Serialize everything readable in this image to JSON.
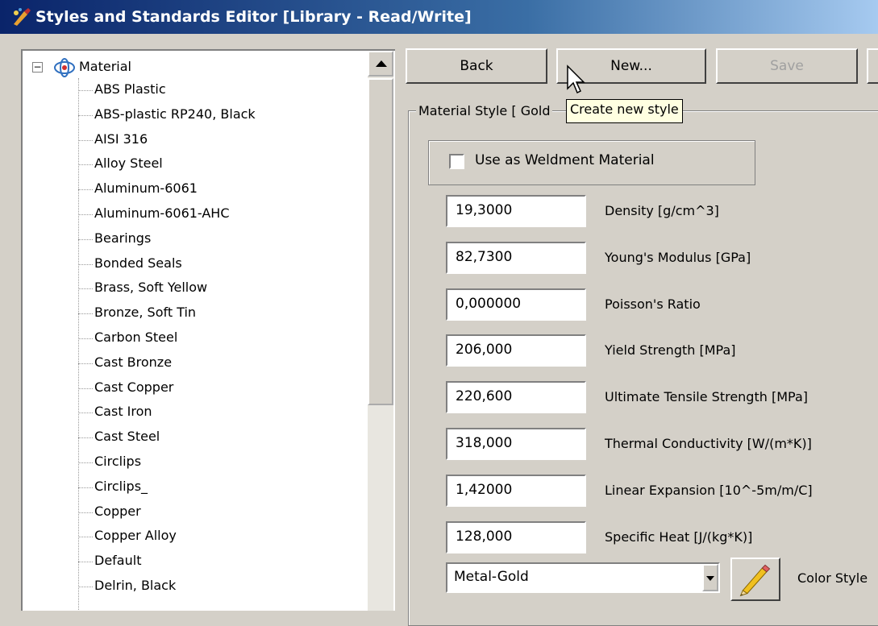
{
  "window": {
    "title": "Styles and Standards Editor [Library - Read/Write]",
    "app_icon": "styles-editor-icon"
  },
  "tree": {
    "root": {
      "label": "Material",
      "expanded": true,
      "icon": "material-icon"
    },
    "items": [
      "ABS Plastic",
      "ABS-plastic RP240, Black",
      "AISI 316",
      "Alloy Steel",
      "Aluminum-6061",
      "Aluminum-6061-AHC",
      "Bearings",
      "Bonded Seals",
      "Brass, Soft Yellow",
      "Bronze, Soft Tin",
      "Carbon Steel",
      "Cast Bronze",
      "Cast Copper",
      "Cast Iron",
      "Cast Steel",
      "Circlips",
      "Circlips_",
      "Copper",
      "Copper Alloy",
      "Default",
      "Delrin, Black"
    ]
  },
  "toolbar": {
    "back_label": "Back",
    "new_label": "New...",
    "save_label": "Save"
  },
  "tooltip": "Create new style",
  "material_style": {
    "group_title": "Material Style [ Gold",
    "weldment_checkbox": {
      "label": "Use as Weldment Material",
      "checked": false
    },
    "properties": [
      {
        "value": "19,3000",
        "label": "Density  [g/cm^3]"
      },
      {
        "value": "82,7300",
        "label": "Young's Modulus  [GPa]"
      },
      {
        "value": "0,000000",
        "label": "Poisson's Ratio"
      },
      {
        "value": "206,000",
        "label": "Yield Strength  [MPa]"
      },
      {
        "value": "220,600",
        "label": "Ultimate Tensile Strength  [MPa]"
      },
      {
        "value": "318,000",
        "label": "Thermal Conductivity  [W/(m*K)]"
      },
      {
        "value": "1,42000",
        "label": "Linear Expansion  [10^-5m/m/C]"
      },
      {
        "value": "128,000",
        "label": "Specific Heat [J/(kg*K)]"
      }
    ],
    "color_style": {
      "value": "Metal-Gold",
      "label": "Color Style",
      "edit_icon": "pencil-icon"
    }
  },
  "colors": {
    "titlebar_start": "#0a246a",
    "titlebar_end": "#a6caf0",
    "window_bg": "#d4d0c8",
    "tooltip_bg": "#ffffe1"
  }
}
